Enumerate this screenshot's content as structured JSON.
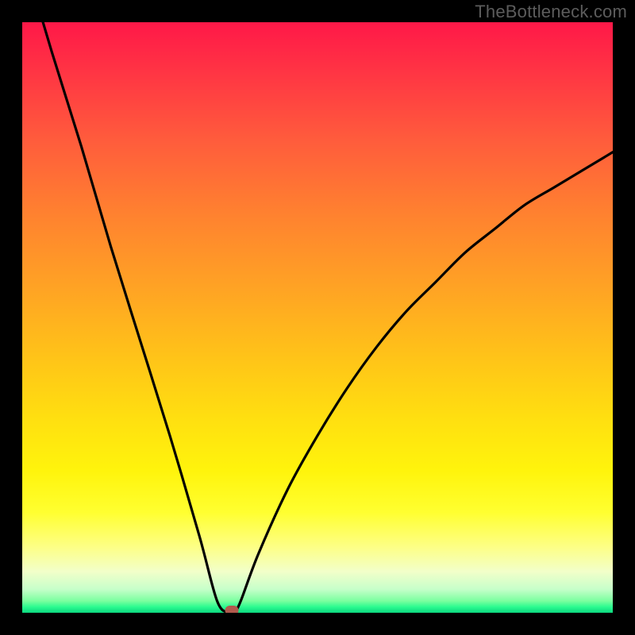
{
  "watermark": "TheBottleneck.com",
  "colors": {
    "frame_border": "#000000",
    "curve_stroke": "#000000",
    "marker_fill": "#b25a4d",
    "gradient_top": "#ff1848",
    "gradient_bottom": "#0cd77e"
  },
  "chart_data": {
    "type": "line",
    "title": "",
    "xlabel": "",
    "ylabel": "",
    "xlim": [
      0,
      100
    ],
    "ylim": [
      0,
      100
    ],
    "grid": false,
    "series": [
      {
        "name": "bottleneck-curve",
        "x": [
          0,
          5,
          10,
          15,
          20,
          25,
          30,
          33,
          35,
          36,
          37,
          40,
          45,
          50,
          55,
          60,
          65,
          70,
          75,
          80,
          85,
          90,
          95,
          100
        ],
        "y": [
          112,
          95,
          79,
          62,
          46,
          30,
          13,
          2,
          0,
          0.2,
          2,
          10,
          21,
          30,
          38,
          45,
          51,
          56,
          61,
          65,
          69,
          72,
          75,
          78
        ]
      }
    ],
    "marker": {
      "x": 35.5,
      "y": 0.4
    },
    "annotations": []
  }
}
